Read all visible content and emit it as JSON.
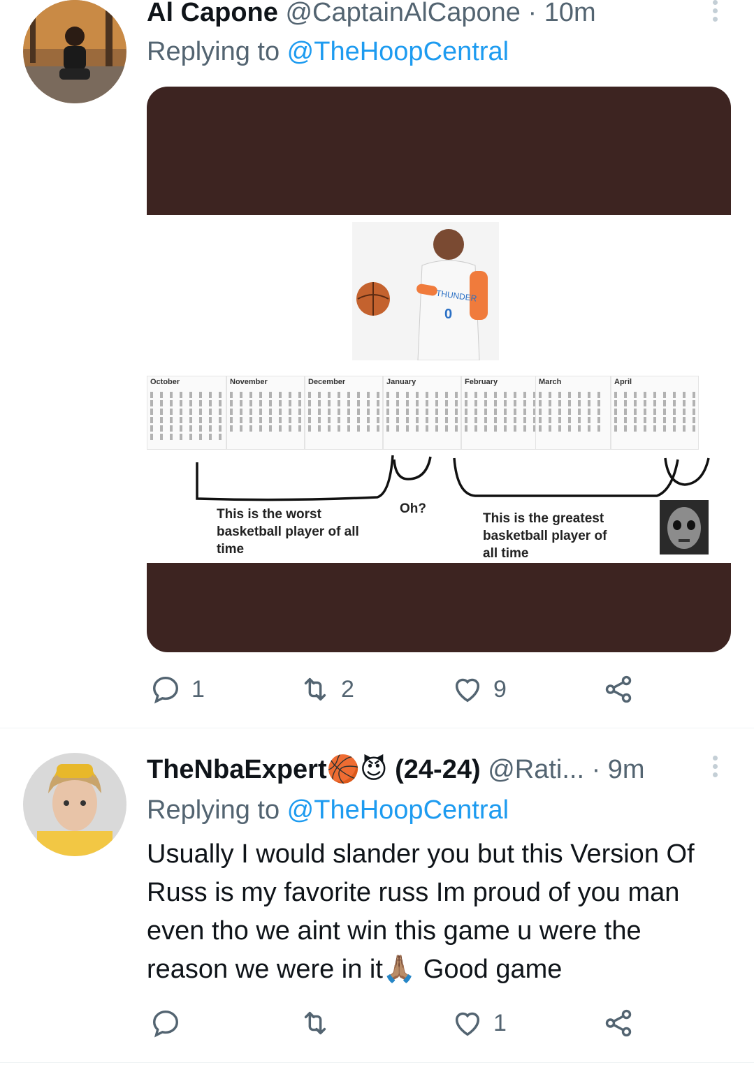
{
  "tweets": [
    {
      "display_name": "Al Capone",
      "handle": "@CaptainAlCapone",
      "separator": "·",
      "time": "10m",
      "replying_prefix": "Replying to ",
      "replying_to": "@TheHoopCentral",
      "meme": {
        "months": [
          "October",
          "November",
          "December",
          "January",
          "February",
          "March",
          "April"
        ],
        "caption_worst": "This is the worst basketball player of all time",
        "caption_oh": "Oh?",
        "caption_greatest": "This is the greatest basketball player of all time",
        "jersey_text": "THUNDER",
        "jersey_number": "0"
      },
      "actions": {
        "replies": "1",
        "retweets": "2",
        "likes": "9",
        "shares": ""
      }
    },
    {
      "display_name": "TheNbaExpert",
      "name_emojis": "🏀😈",
      "name_suffix": "(24-24)",
      "handle": "@Rati...",
      "separator": "·",
      "time": "9m",
      "replying_prefix": "Replying to ",
      "replying_to": "@TheHoopCentral",
      "text": "Usually I would slander you but this Version Of Russ is my favorite russ Im proud of you man even tho we aint win this game u were the reason we were in it🙏🏽 Good game",
      "actions": {
        "replies": "",
        "retweets": "",
        "likes": "1",
        "shares": ""
      }
    }
  ],
  "colors": {
    "text": "#0f1419",
    "secondary": "#536471",
    "mention": "#1d9bf0",
    "media_background": "#3d2421"
  },
  "icons": [
    "reply-icon",
    "retweet-icon",
    "like-icon",
    "share-icon",
    "more-icon"
  ]
}
